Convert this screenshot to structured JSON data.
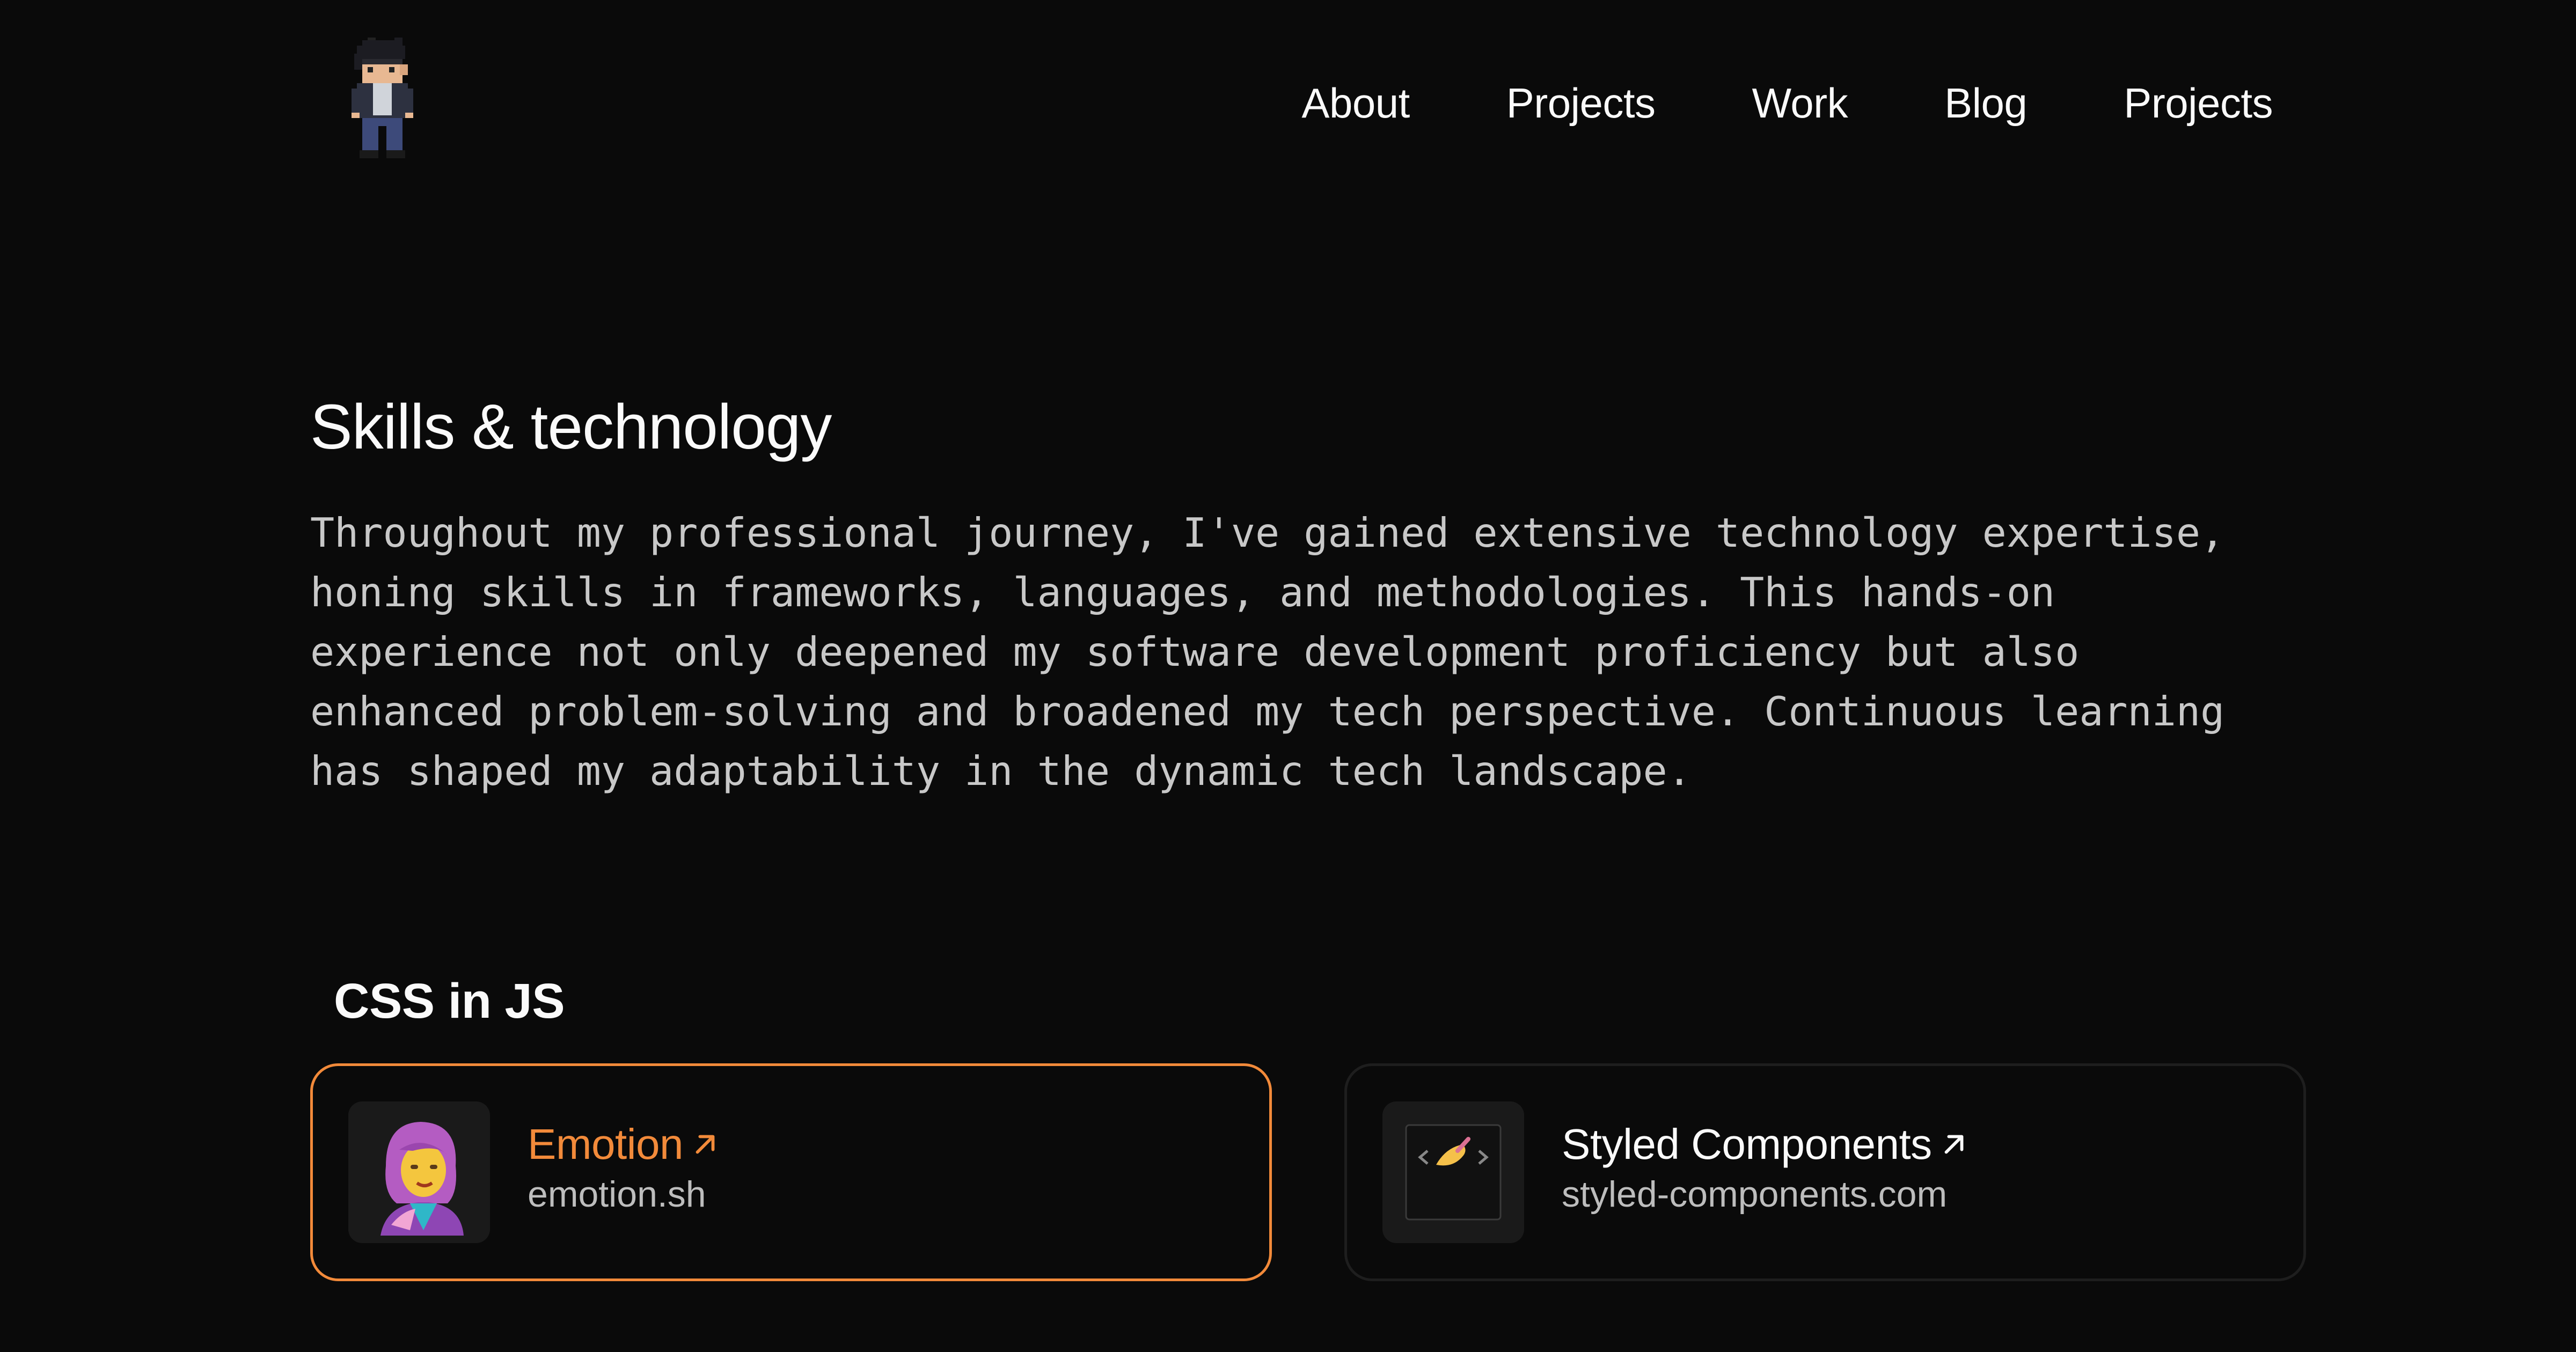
{
  "header": {
    "logo_icon": "pixel-avatar-icon",
    "nav": [
      {
        "label": "About"
      },
      {
        "label": "Projects"
      },
      {
        "label": "Work"
      },
      {
        "label": "Blog"
      },
      {
        "label": "Projects"
      }
    ]
  },
  "section": {
    "title": "Skills & technology",
    "intro": "Throughout my professional journey, I've gained extensive technology expertise,\nhoning skills in frameworks, languages, and methodologies. This hands-on\nexperience not only deepened my software development proficiency but also\nenhanced problem-solving and broadened my tech perspective. Continuous learning\nhas shaped my adaptability in the dynamic tech landscape."
  },
  "group": {
    "title": "CSS in JS",
    "items": [
      {
        "name": "Emotion",
        "domain": "emotion.sh",
        "icon": "emotion-logo-icon",
        "active": true
      },
      {
        "name": "Styled Components",
        "domain": "styled-components.com",
        "icon": "styled-components-logo-icon",
        "active": false
      }
    ]
  },
  "colors": {
    "background": "#0a0a0a",
    "accent": "#f28a3a",
    "text": "#fafafa",
    "muted": "#c8c8c8",
    "card_border": "#1e1e1e"
  }
}
